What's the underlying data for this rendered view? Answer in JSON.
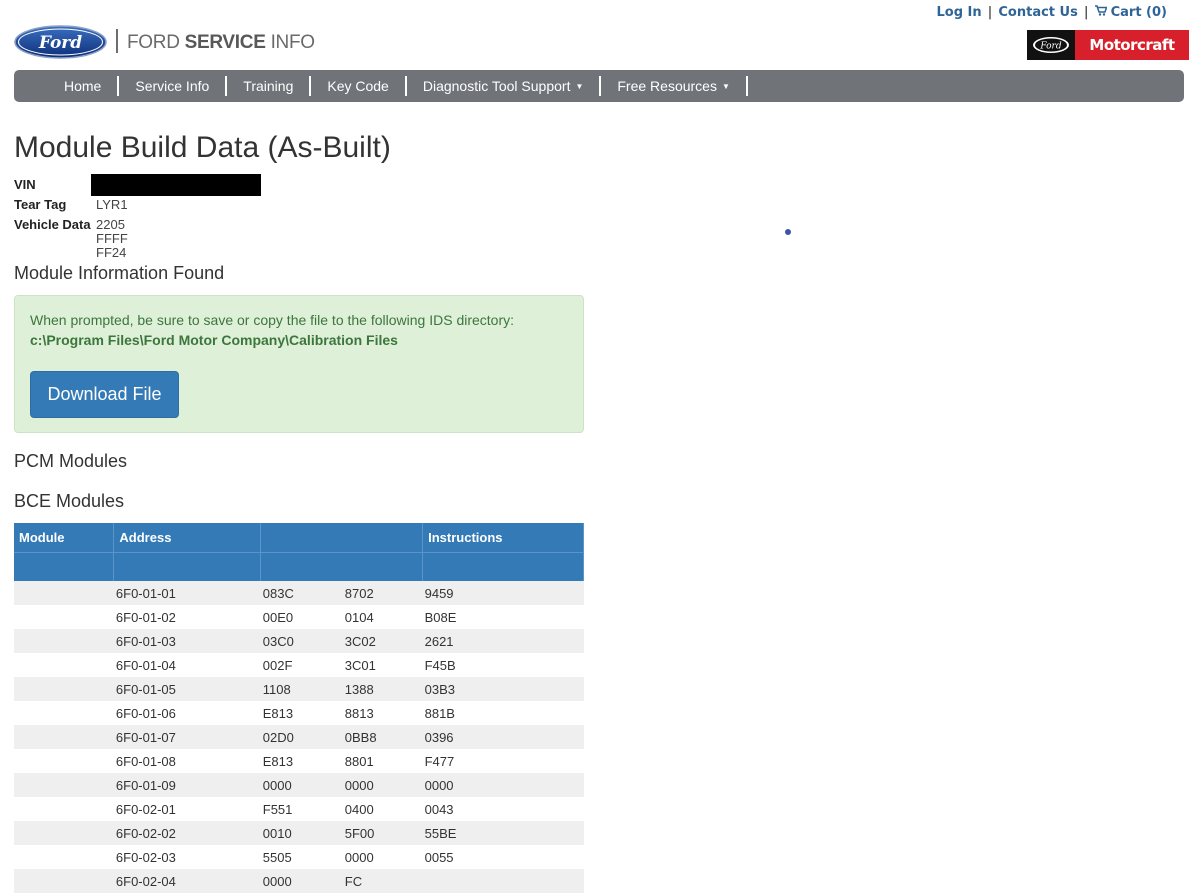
{
  "topbar": {
    "login": "Log In",
    "contact": "Contact Us",
    "cart": "Cart (0)"
  },
  "brand": {
    "logo_text": "Ford",
    "name_light": "FORD ",
    "name_bold": "SERVICE",
    "name_tail": " INFO",
    "partner_oval": "Ford",
    "partner": "Motorcraft"
  },
  "nav": {
    "items": [
      {
        "label": "Home"
      },
      {
        "label": "Service Info"
      },
      {
        "label": "Training"
      },
      {
        "label": "Key Code"
      },
      {
        "label": "Diagnostic Tool Support",
        "caret": "▼"
      },
      {
        "label": "Free Resources",
        "caret": "▼"
      }
    ]
  },
  "page": {
    "title": "Module Build Data (As-Built)"
  },
  "vehicle": {
    "vin_label": "VIN",
    "tear_tag_label": "Tear Tag",
    "tear_tag": "LYR1",
    "vehicle_data_label": "Vehicle Data",
    "vehicle_data": "2205 FFFF FF24"
  },
  "module_info": {
    "heading": "Module Information Found",
    "instruction": "When prompted, be sure to save or copy the file to the following IDS directory:",
    "path": "c:\\Program Files\\Ford Motor Company\\Calibration Files",
    "download_label": "Download File"
  },
  "sections": {
    "pcm": "PCM Modules",
    "bce": "BCE Modules"
  },
  "table": {
    "headers": [
      "Module",
      "Address",
      "",
      "Instructions"
    ],
    "rows": [
      [
        "",
        "6F0-01-01",
        "083C",
        "8702",
        "9459"
      ],
      [
        "",
        "6F0-01-02",
        "00E0",
        "0104",
        "B08E"
      ],
      [
        "",
        "6F0-01-03",
        "03C0",
        "3C02",
        "2621"
      ],
      [
        "",
        "6F0-01-04",
        "002F",
        "3C01",
        "F45B"
      ],
      [
        "",
        "6F0-01-05",
        "1108",
        "1388",
        "03B3"
      ],
      [
        "",
        "6F0-01-06",
        "E813",
        "8813",
        "881B"
      ],
      [
        "",
        "6F0-01-07",
        "02D0",
        "0BB8",
        "0396"
      ],
      [
        "",
        "6F0-01-08",
        "E813",
        "8801",
        "F477"
      ],
      [
        "",
        "6F0-01-09",
        "0000",
        "0000",
        "0000"
      ],
      [
        "",
        "6F0-02-01",
        "F551",
        "0400",
        "0043"
      ],
      [
        "",
        "6F0-02-02",
        "0010",
        "5F00",
        "55BE"
      ],
      [
        "",
        "6F0-02-03",
        "5505",
        "0000",
        "0055"
      ],
      [
        "",
        "6F0-02-04",
        "0000",
        "FC",
        ""
      ]
    ]
  },
  "colors": {
    "nav_bg": "#707378",
    "primary": "#337ab7",
    "alert_bg": "#dff0d8",
    "alert_text": "#3c763d",
    "motorcraft_red": "#d8202c",
    "link": "#2f6496"
  }
}
